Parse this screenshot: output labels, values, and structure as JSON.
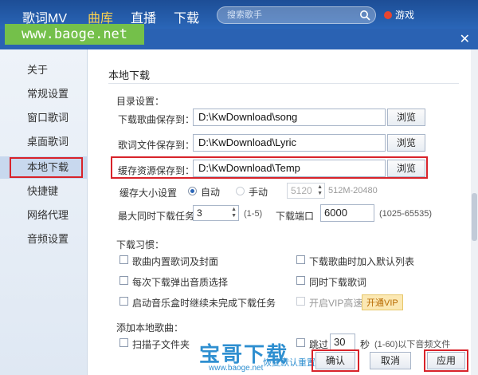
{
  "topnav": [
    {
      "label": "歌词MV",
      "active": false
    },
    {
      "label": "曲库",
      "active": true
    },
    {
      "label": "直播",
      "active": false
    },
    {
      "label": "下载",
      "active": false
    }
  ],
  "search": {
    "placeholder": "搜索歌手"
  },
  "user": {
    "label": "游戏"
  },
  "brand": {
    "text": "www.baoge.net"
  },
  "sidebar": {
    "items": [
      {
        "label": "关于"
      },
      {
        "label": "常规设置"
      },
      {
        "label": "窗口歌词"
      },
      {
        "label": "桌面歌词"
      },
      {
        "label": "本地下载"
      },
      {
        "label": "快捷键"
      },
      {
        "label": "网络代理"
      },
      {
        "label": "音频设置"
      }
    ]
  },
  "main": {
    "section_title": "本地下载",
    "dir_title": "目录设置：",
    "dirs": [
      {
        "label": "下载歌曲保存到：",
        "value": "D:\\KwDownload\\song"
      },
      {
        "label": "歌词文件保存到：",
        "value": "D:\\KwDownload\\Lyric"
      },
      {
        "label": "缓存资源保存到：",
        "value": "D:\\KwDownload\\Temp"
      }
    ],
    "browse_label": "浏览",
    "cache": {
      "label": "缓存大小设置",
      "auto_label": "自动",
      "manual_label": "手动",
      "size_value": "5120",
      "size_hint": "512M-20480"
    },
    "max_tasks": {
      "label": "最大同时下载任务",
      "value": "3",
      "hint": "(1-5)"
    },
    "port": {
      "label": "下载端口",
      "value": "6000",
      "hint": "(1025-65535)"
    },
    "habits_title": "下载习惯：",
    "habits": [
      {
        "label": "歌曲内置歌词及封面"
      },
      {
        "label": "下载歌曲时加入默认列表"
      },
      {
        "label": "每次下载弹出音质选择"
      },
      {
        "label": "同时下载歌词"
      },
      {
        "label": "启动音乐盒时继续未完成下载任务"
      },
      {
        "label": "开启VIP高速"
      }
    ],
    "vip_badge": "开通VIP",
    "add_title": "添加本地歌曲：",
    "scan_label": "扫描子文件夹",
    "skip_label": "跳过",
    "skip_value": "30",
    "skip_unit": "秒",
    "skip_hint": "(1-60)以下音频文件"
  },
  "footer": {
    "reset_label": "恢复默认重置",
    "ok_label": "确认",
    "cancel_label": "取消",
    "apply_label": "应用"
  },
  "watermark": {
    "title": "宝哥下载",
    "url": "www.baoge.net"
  }
}
